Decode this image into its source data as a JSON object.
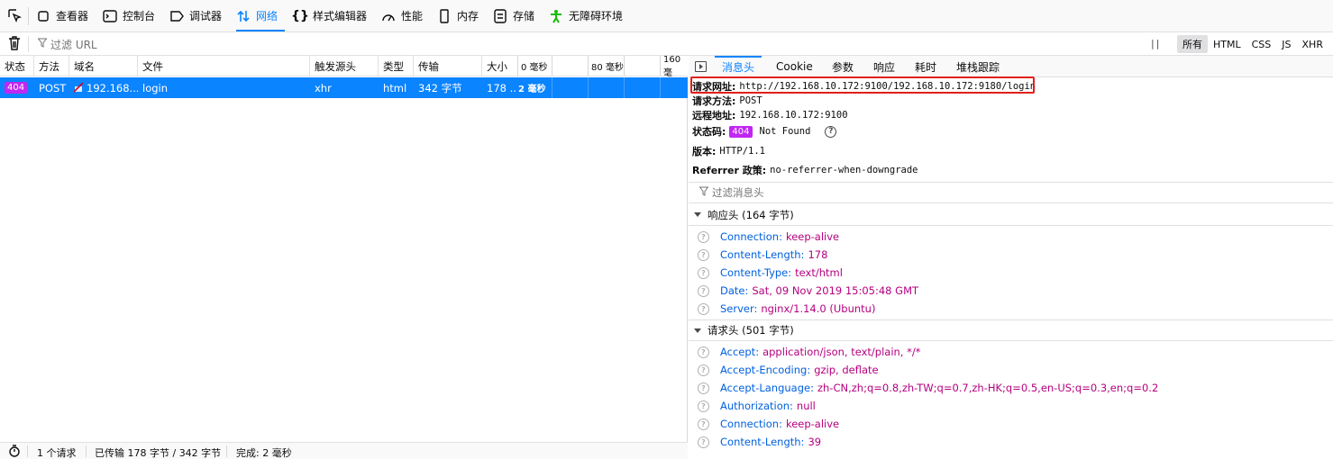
{
  "toolbar": {
    "tabs": [
      {
        "label": "查看器",
        "icon": "inspector-icon"
      },
      {
        "label": "控制台",
        "icon": "console-icon"
      },
      {
        "label": "调试器",
        "icon": "debugger-icon"
      },
      {
        "label": "网络",
        "icon": "network-icon"
      },
      {
        "label": "样式编辑器",
        "icon": "style-editor-icon"
      },
      {
        "label": "性能",
        "icon": "performance-icon"
      },
      {
        "label": "内存",
        "icon": "memory-icon"
      },
      {
        "label": "存储",
        "icon": "storage-icon"
      },
      {
        "label": "无障碍环境",
        "icon": "accessibility-icon"
      }
    ],
    "selected": "网络"
  },
  "filterbar": {
    "placeholder": "过滤 URL",
    "type_filters": [
      "所有",
      "HTML",
      "CSS",
      "JS",
      "XHR"
    ],
    "active_type": "所有"
  },
  "list": {
    "columns": [
      "状态",
      "方法",
      "域名",
      "文件",
      "触发源头",
      "类型",
      "传输",
      "大小"
    ],
    "waterfall_ticks": [
      "0 毫秒",
      "80 毫秒",
      "160 毫"
    ],
    "rows": [
      {
        "status": "404",
        "method": "POST",
        "domain": "192.168....",
        "file": "login",
        "cause": "xhr",
        "type": "html",
        "transferred": "342 字节",
        "size": "178 ...",
        "timing": "2 毫秒"
      }
    ]
  },
  "statusbar": {
    "requests": "1 个请求",
    "transferred": "已传输 178 字节 / 342 字节",
    "finish": "完成: 2 毫秒"
  },
  "details": {
    "tabs": [
      "消息头",
      "Cookie",
      "参数",
      "响应",
      "耗时",
      "堆栈跟踪"
    ],
    "active_tab": "消息头",
    "summary": {
      "url_label": "请求网址:",
      "url": "http://192.168.10.172:9100/192.168.10.172:9180/login",
      "method_label": "请求方法:",
      "method": "POST",
      "remote_label": "远程地址:",
      "remote": "192.168.10.172:9100",
      "status_label": "状态码:",
      "status_code": "404",
      "status_text": "Not Found",
      "version_label": "版本:",
      "version": "HTTP/1.1",
      "referrer_label": "Referrer 政策:",
      "referrer": "no-referrer-when-downgrade"
    },
    "filter_placeholder": "过滤消息头",
    "response_headers_title": "响应头 (164 字节)",
    "response_headers": [
      {
        "name": "Connection:",
        "value": "keep-alive"
      },
      {
        "name": "Content-Length:",
        "value": "178"
      },
      {
        "name": "Content-Type:",
        "value": "text/html"
      },
      {
        "name": "Date:",
        "value": "Sat, 09 Nov 2019 15:05:48 GMT"
      },
      {
        "name": "Server:",
        "value": "nginx/1.14.0 (Ubuntu)"
      }
    ],
    "request_headers_title": "请求头 (501 字节)",
    "request_headers": [
      {
        "name": "Accept:",
        "value": "application/json, text/plain, */*"
      },
      {
        "name": "Accept-Encoding:",
        "value": "gzip, deflate"
      },
      {
        "name": "Accept-Language:",
        "value": "zh-CN,zh;q=0.8,zh-TW;q=0.7,zh-HK;q=0.5,en-US;q=0.3,en;q=0.2"
      },
      {
        "name": "Authorization:",
        "value": "null"
      },
      {
        "name": "Connection:",
        "value": "keep-alive"
      },
      {
        "name": "Content-Length:",
        "value": "39"
      }
    ]
  },
  "colors": {
    "accent": "#0a84ff",
    "badge_404": "#c027f2",
    "highlight_box": "#e0201c",
    "header_name": "#0060df",
    "header_value": "#b5007f"
  }
}
